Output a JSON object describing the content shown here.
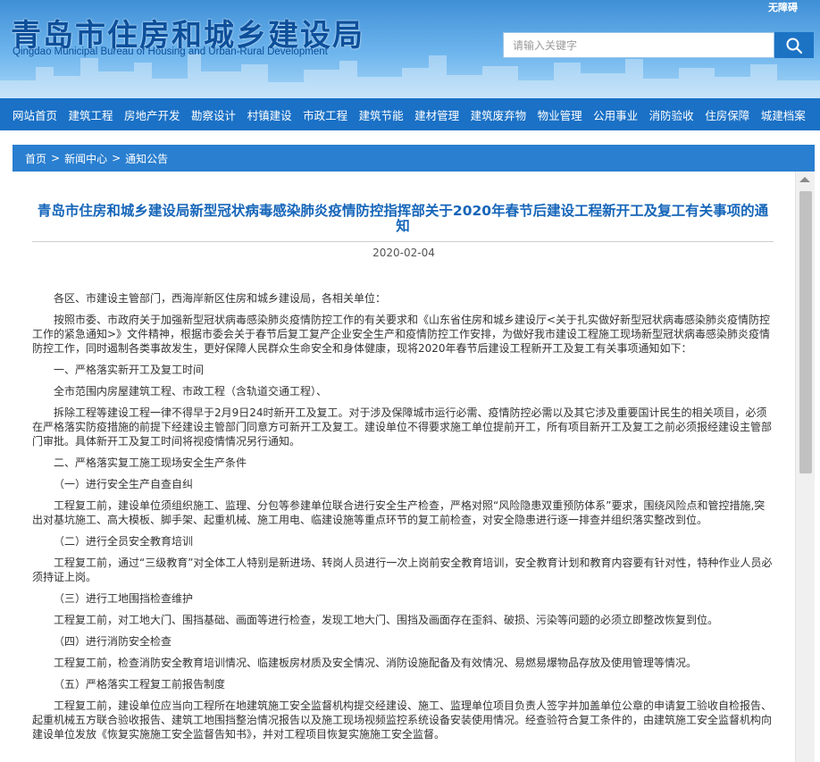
{
  "header": {
    "title_cn": "青岛市住房和城乡建设局",
    "title_en": "Qingdao Municipal Bureau of Housing and Urban-Rural Development",
    "accessibility": "无障碍",
    "search_placeholder": "请输入关键字"
  },
  "nav": {
    "items": [
      "网站首页",
      "建筑工程",
      "房地产开发",
      "勘察设计",
      "村镇建设",
      "市政工程",
      "建筑节能",
      "建材管理",
      "建筑废弃物",
      "物业管理",
      "公用事业",
      "消防验收",
      "住房保障",
      "城建档案"
    ]
  },
  "breadcrumb": {
    "items": [
      "首页",
      "新闻中心",
      "通知公告"
    ],
    "separator": ">"
  },
  "article": {
    "title": "青岛市住房和城乡建设局新型冠状病毒感染肺炎疫情防控指挥部关于2020年春节后建设工程新开工及复工有关事项的通知",
    "date": "2020-02-04",
    "paragraphs": [
      "各区、市建设主管部门，西海岸新区住房和城乡建设局，各相关单位：",
      "按照市委、市政府关于加强新型冠状病毒感染肺炎疫情防控工作的有关要求和《山东省住房和城乡建设厅<关于扎实做好新型冠状病毒感染肺炎疫情防控工作的紧急通知>》文件精神，根据市委会关于春节后复工复产企业安全生产和疫情防控工作安排，为做好我市建设工程施工现场新型冠状病毒感染肺炎疫情防控工作，同时遏制各类事故发生，更好保障人民群众生命安全和身体健康，现将2020年春节后建设工程新开工及复工有关事项通知如下：",
      "一、严格落实新开工及复工时间",
      "全市范围内房屋建筑工程、市政工程（含轨道交通工程）、",
      "拆除工程等建设工程一律不得早于2月9日24时新开工及复工。对于涉及保障城市运行必需、疫情防控必需以及其它涉及重要国计民生的相关项目，必须在严格落实防疫措施的前提下经建设主管部门同意方可新开工及复工。建设单位不得要求施工单位提前开工，所有项目新开工及复工之前必须报经建设主管部门审批。具体新开工及复工时间将视疫情情况另行通知。",
      "二、严格落实复工施工现场安全生产条件",
      "（一）进行安全生产自查自纠",
      "工程复工前，建设单位须组织施工、监理、分包等参建单位联合进行安全生产检查，严格对照“风险隐患双重预防体系”要求，围绕风险点和管控措施,突出对基坑施工、高大模板、脚手架、起重机械、施工用电、临建设施等重点环节的复工前检查，对安全隐患进行逐一排查并组织落实整改到位。",
      "（二）进行全员安全教育培训",
      "工程复工前，通过“三级教育”对全体工人特别是新进场、转岗人员进行一次上岗前安全教育培训，安全教育计划和教育内容要有针对性，特种作业人员必须持证上岗。",
      "（三）进行工地围挡检查维护",
      "工程复工前，对工地大门、围挡基础、画面等进行检查，发现工地大门、围挡及画面存在歪斜、破损、污染等问题的必须立即整改恢复到位。",
      "（四）进行消防安全检查",
      "工程复工前，检查消防安全教育培训情况、临建板房材质及安全情况、消防设施配备及有效情况、易燃易爆物品存放及使用管理等情况。",
      "（五）严格落实工程复工前报告制度",
      "工程复工前，建设单位应当向工程所在地建筑施工安全监督机构提交经建设、施工、监理单位项目负责人签字并加盖单位公章的申请复工验收自检报告、起重机械五方联合验收报告、建筑工地围挡整治情况报告以及施工现场视频监控系统设备安装使用情况。经查验符合复工条件的，由建筑施工安全监督机构向建设单位发放《恢复实施施工安全监督告知书》，并对工程项目恢复实施施工安全监督。"
    ]
  },
  "colors": {
    "nav_bg": "#1a71c6",
    "title_blue": "#1565b9",
    "header_gradient_top": "#3f8fd6"
  },
  "icons": {
    "search": "search-icon"
  }
}
